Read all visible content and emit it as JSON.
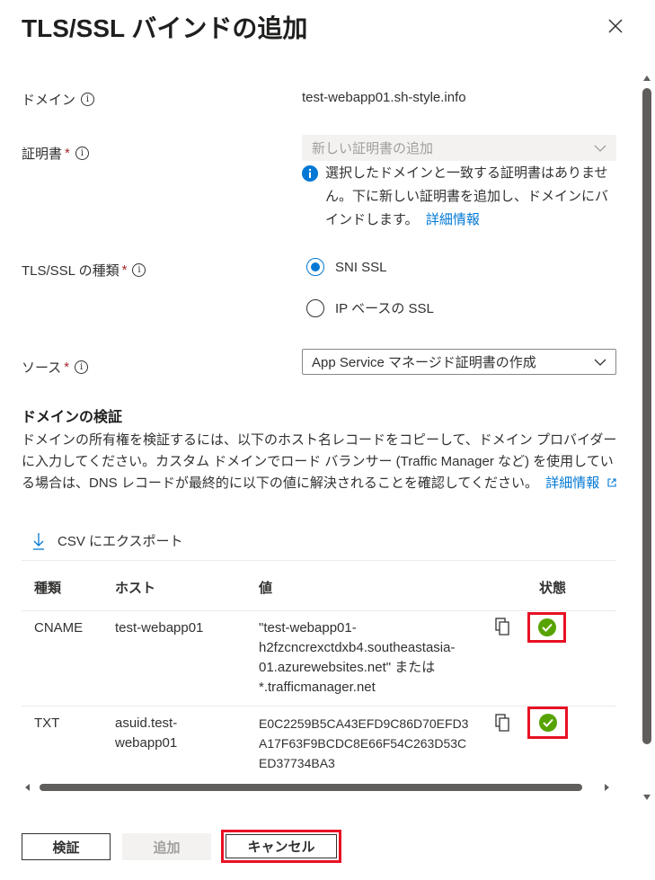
{
  "panel": {
    "title": "TLS/SSL バインドの追加",
    "close_icon": "close-icon"
  },
  "form": {
    "domain": {
      "label": "ドメイン",
      "value": "test-webapp01.sh-style.info"
    },
    "certificate": {
      "label": "証明書",
      "required_mark": "*",
      "placeholder": "新しい証明書の追加",
      "info_text": "選択したドメインと一致する証明書はありません。下に新しい証明書を追加し、ドメインにバインドします。",
      "info_link": "詳細情報"
    },
    "tls_type": {
      "label": "TLS/SSL の種類",
      "required_mark": "*",
      "options": [
        {
          "label": "SNI SSL",
          "selected": true
        },
        {
          "label": "IP ベースの SSL",
          "selected": false
        }
      ]
    },
    "source": {
      "label": "ソース",
      "required_mark": "*",
      "value": "App Service マネージド証明書の作成"
    }
  },
  "verification": {
    "heading": "ドメインの検証",
    "description": "ドメインの所有権を検証するには、以下のホスト名レコードをコピーして、ドメイン プロバイダーに入力してください。カスタム ドメインでロード バランサー (Traffic Manager など) を使用している場合は、DNS レコードが最終的に以下の値に解決されることを確認してください。",
    "link": "詳細情報",
    "export_label": "CSV にエクスポート",
    "columns": [
      "種類",
      "ホスト",
      "値",
      "状態"
    ],
    "rows": [
      {
        "type": "CNAME",
        "host": "test-webapp01",
        "value_lines": [
          "\"test-webapp01-",
          "h2fzcncrexctdxb4.southeastasia-",
          "01.azurewebsites.net\" または",
          "*.trafficmanager.net"
        ],
        "status": "success"
      },
      {
        "type": "TXT",
        "host_lines": [
          "asuid.test-",
          "webapp01"
        ],
        "value_lines": [
          "E0C2259B5CA43EFD9C86D70EFD3",
          "A17F63F9BCDC8E66F54C263D53C",
          "ED37734BA3"
        ],
        "status": "success"
      }
    ]
  },
  "footer": {
    "verify_label": "検証",
    "add_label": "追加",
    "cancel_label": "キャンセル"
  },
  "colors": {
    "accent": "#0078d4",
    "success": "#57a300",
    "highlight": "#e81123",
    "required": "#a4262c"
  }
}
